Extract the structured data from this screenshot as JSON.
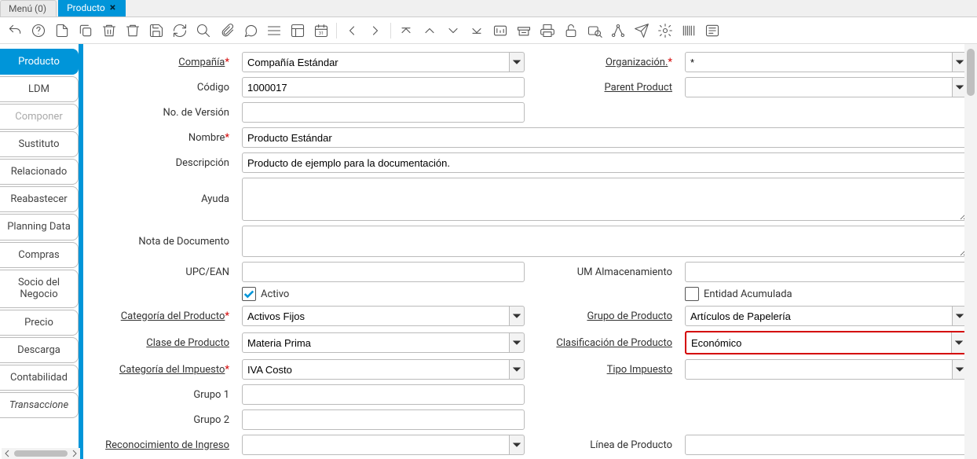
{
  "tabs": [
    {
      "label": "Menú (0)",
      "active": false
    },
    {
      "label": "Producto",
      "active": true
    }
  ],
  "toolbar_icons": [
    "undo-icon",
    "help-icon",
    "new-icon",
    "copy-icon",
    "delete-line-icon",
    "delete-icon",
    "save-icon",
    "refresh-icon",
    "find-icon",
    "attach-icon",
    "chat-icon",
    "multi-icon",
    "form-icon",
    "date-icon",
    "nav-first-sep",
    "nav-prev-icon",
    "nav-next-icon",
    "nav-first-icon",
    "nav-up-icon",
    "nav-down-icon",
    "nav-last-icon",
    "report-icon",
    "archive-icon",
    "print-icon",
    "lock-icon",
    "zoom-icon",
    "workflow-icon",
    "send-icon",
    "settings-icon",
    "barcode-icon",
    "account-icon"
  ],
  "sidebar": {
    "items": [
      {
        "label": "Producto",
        "state": "active"
      },
      {
        "label": "LDM",
        "state": ""
      },
      {
        "label": "Componer",
        "state": "disabled"
      },
      {
        "label": "Sustituto",
        "state": ""
      },
      {
        "label": "Relacionado",
        "state": ""
      },
      {
        "label": "Reabastecer",
        "state": ""
      },
      {
        "label": "Planning Data",
        "state": ""
      },
      {
        "label": "Compras",
        "state": ""
      },
      {
        "label": "Socio del Negocio",
        "state": ""
      },
      {
        "label": "Precio",
        "state": ""
      },
      {
        "label": "Descarga",
        "state": ""
      },
      {
        "label": "Contabilidad",
        "state": ""
      },
      {
        "label": "Transaccione",
        "state": "italic"
      }
    ]
  },
  "form": {
    "company": {
      "label": "Compañía",
      "value": "Compañía Estándar"
    },
    "organization": {
      "label": "Organización.",
      "value": "*"
    },
    "code": {
      "label": "Código",
      "value": "1000017"
    },
    "parent_product": {
      "label": "Parent Product",
      "value": ""
    },
    "version_no": {
      "label": "No. de Versión",
      "value": ""
    },
    "name": {
      "label": "Nombre",
      "value": "Producto Estándar"
    },
    "description": {
      "label": "Descripción",
      "value": "Producto de ejemplo para la documentación."
    },
    "help": {
      "label": "Ayuda",
      "value": ""
    },
    "doc_note": {
      "label": "Nota de Documento",
      "value": ""
    },
    "upc": {
      "label": "UPC/EAN",
      "value": ""
    },
    "um_storage": {
      "label": "UM Almacenamiento",
      "value": ""
    },
    "active": {
      "label": "Activo",
      "checked": true
    },
    "entity_acc": {
      "label": "Entidad Acumulada",
      "checked": false
    },
    "prod_category": {
      "label": "Categoría del Producto",
      "value": "Activos Fijos"
    },
    "prod_group": {
      "label": "Grupo de Producto",
      "value": "Artículos de Papelería"
    },
    "prod_class": {
      "label": "Clase de Producto",
      "value": "Materia Prima"
    },
    "prod_classification": {
      "label": "Clasificación de Producto",
      "value": "Económico"
    },
    "tax_category": {
      "label": "Categoría del Impuesto",
      "value": "IVA Costo"
    },
    "tax_type": {
      "label": "Tipo Impuesto",
      "value": ""
    },
    "group1": {
      "label": "Grupo 1",
      "value": ""
    },
    "group2": {
      "label": "Grupo 2",
      "value": ""
    },
    "revenue_recognition": {
      "label": "Reconocimiento de Ingreso",
      "value": ""
    },
    "product_line": {
      "label": "Línea de Producto",
      "value": ""
    }
  }
}
